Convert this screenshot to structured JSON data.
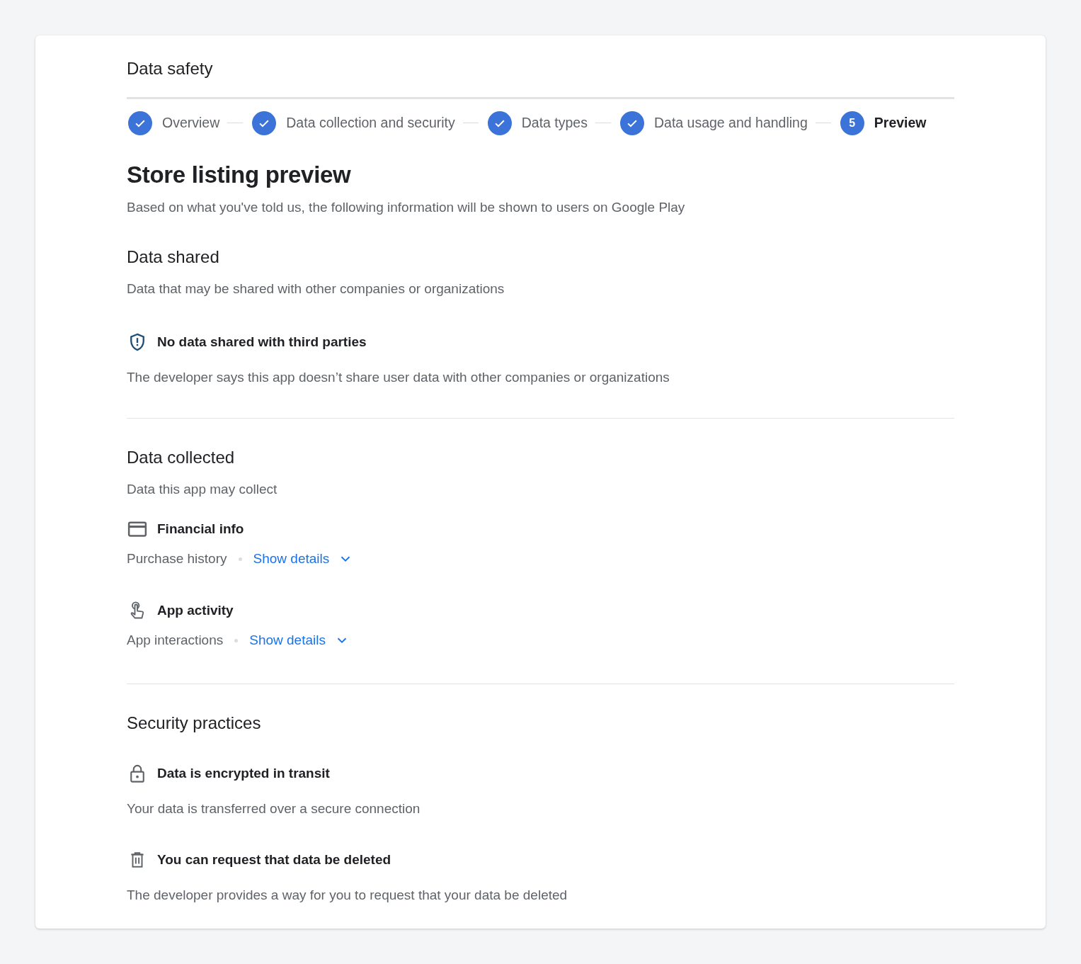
{
  "page": {
    "title": "Data safety"
  },
  "steps": [
    {
      "label": "Overview",
      "completed": true,
      "selected": false
    },
    {
      "label": "Data collection and security",
      "completed": true,
      "selected": false
    },
    {
      "label": "Data types",
      "completed": true,
      "selected": false
    },
    {
      "label": "Data usage and handling",
      "completed": true,
      "selected": false
    },
    {
      "label": "Preview",
      "number": "5",
      "completed": false,
      "selected": true
    }
  ],
  "preview": {
    "title": "Store listing preview",
    "subtitle": "Based on what you've told us, the following information will be shown to users on Google Play"
  },
  "data_shared": {
    "title": "Data shared",
    "subtitle": "Data that may be shared with other companies or organizations",
    "items": [
      {
        "kind": "shield",
        "title": "No data shared with third parties",
        "description": "The developer says this app doesn’t share user data with other companies or organizations"
      }
    ]
  },
  "data_collected": {
    "title": "Data collected",
    "subtitle": "Data this app may collect",
    "categories": [
      {
        "kind": "card",
        "title": "Financial info",
        "types": "Purchase history",
        "link": "Show details",
        "expanded": false
      },
      {
        "kind": "touch",
        "title": "App activity",
        "types": "App interactions",
        "link": "Show details",
        "expanded": false
      }
    ]
  },
  "security_practices": {
    "title": "Security practices",
    "items": [
      {
        "kind": "lock",
        "title": "Data is encrypted in transit",
        "description": "Your data is transferred over a secure connection"
      },
      {
        "kind": "trash",
        "title": "You can request that data be deleted",
        "description": "The developer provides a way for you to request that your data be deleted"
      }
    ]
  }
}
